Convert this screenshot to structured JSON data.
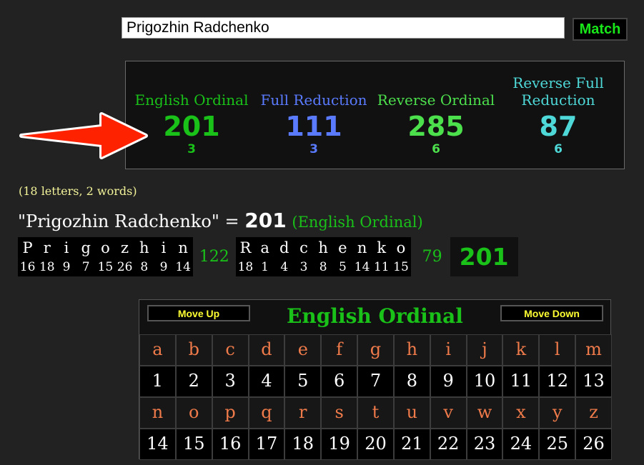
{
  "search": {
    "value": "Prigozhin Radchenko",
    "button": "Match"
  },
  "ciphers": [
    {
      "name": "English Ordinal",
      "value": "201",
      "sub": "3",
      "color": "#19c119",
      "value_color": "#19c119"
    },
    {
      "name": "Full Reduction",
      "value": "111",
      "sub": "3",
      "color": "#5a7bff",
      "value_color": "#5a7bff"
    },
    {
      "name": "Reverse Ordinal",
      "value": "285",
      "sub": "6",
      "color": "#4de04d",
      "value_color": "#4de04d"
    },
    {
      "name": "Reverse Full Reduction",
      "value": "87",
      "sub": "6",
      "color": "#4fd8d8",
      "value_color": "#4fd8d8"
    }
  ],
  "arrow": {
    "icon": "red-arrow-icon",
    "color": "#ff2200"
  },
  "stats": {
    "letters_words": "(18 letters, 2 words)"
  },
  "phrase": {
    "quoted": "\"Prigozhin Radchenko\"",
    "equals": " = ",
    "value": "201",
    "cipher": "(English Ordinal)"
  },
  "breakdown": {
    "words": [
      {
        "letters": [
          [
            "P",
            "16"
          ],
          [
            "r",
            "18"
          ],
          [
            "i",
            "9"
          ],
          [
            "g",
            "7"
          ],
          [
            "o",
            "15"
          ],
          [
            "z",
            "26"
          ],
          [
            "h",
            "8"
          ],
          [
            "i",
            "9"
          ],
          [
            "n",
            "14"
          ]
        ],
        "total": "122"
      },
      {
        "letters": [
          [
            "R",
            "18"
          ],
          [
            "a",
            "1"
          ],
          [
            "d",
            "4"
          ],
          [
            "c",
            "3"
          ],
          [
            "h",
            "8"
          ],
          [
            "e",
            "5"
          ],
          [
            "n",
            "14"
          ],
          [
            "k",
            "11"
          ],
          [
            "o",
            "15"
          ]
        ],
        "total": "79"
      }
    ],
    "grand_total": "201"
  },
  "chart": {
    "title": "English Ordinal",
    "move_up": "Move Up",
    "move_down": "Move Down",
    "rows": [
      {
        "type": "letter",
        "cells": [
          "a",
          "b",
          "c",
          "d",
          "e",
          "f",
          "g",
          "h",
          "i",
          "j",
          "k",
          "l",
          "m"
        ]
      },
      {
        "type": "number",
        "cells": [
          "1",
          "2",
          "3",
          "4",
          "5",
          "6",
          "7",
          "8",
          "9",
          "10",
          "11",
          "12",
          "13"
        ]
      },
      {
        "type": "letter",
        "cells": [
          "n",
          "o",
          "p",
          "q",
          "r",
          "s",
          "t",
          "u",
          "v",
          "w",
          "x",
          "y",
          "z"
        ]
      },
      {
        "type": "number",
        "cells": [
          "14",
          "15",
          "16",
          "17",
          "18",
          "19",
          "20",
          "21",
          "22",
          "23",
          "24",
          "25",
          "26"
        ]
      }
    ]
  }
}
